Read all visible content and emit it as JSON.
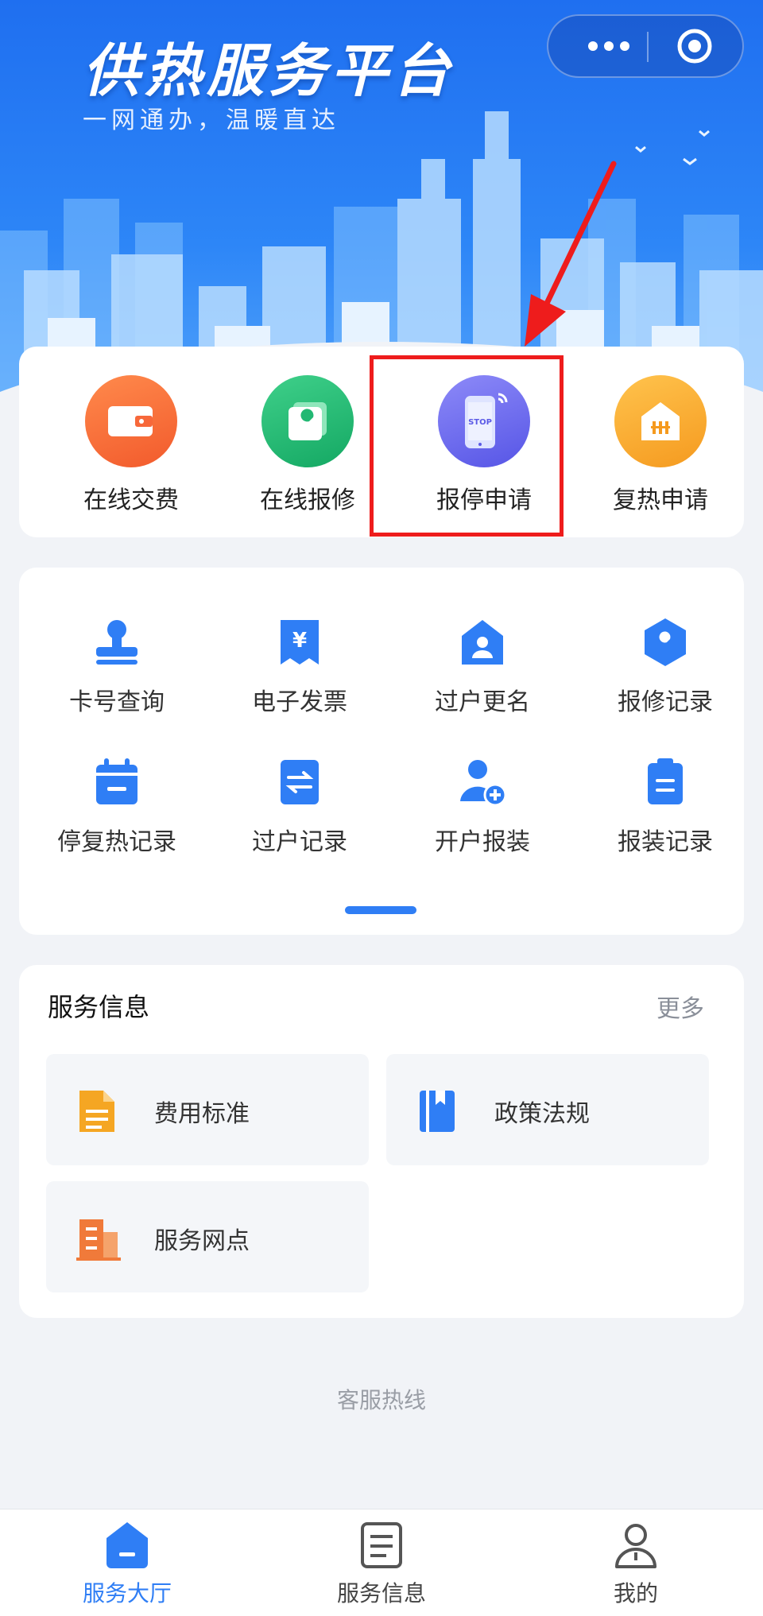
{
  "header": {
    "title": "供热服务平台",
    "subtitle": "一网通办，温暖直达",
    "more_icon": "more-dots-icon",
    "close_icon": "target-icon"
  },
  "quick_actions": [
    {
      "label": "在线交费",
      "icon": "wallet-icon",
      "color": "#f7683a"
    },
    {
      "label": "在线报修",
      "icon": "wrench-icon",
      "color": "#22b873"
    },
    {
      "label": "报停申请",
      "icon": "stop-phone-icon",
      "color": "#6d6cf0",
      "highlighted": true
    },
    {
      "label": "复热申请",
      "icon": "heater-house-icon",
      "color": "#f7a52b"
    }
  ],
  "services": [
    {
      "label": "卡号查询",
      "icon": "stamp-icon"
    },
    {
      "label": "电子发票",
      "icon": "yuan-receipt-icon"
    },
    {
      "label": "过户更名",
      "icon": "house-user-icon"
    },
    {
      "label": "报修记录",
      "icon": "wrench-hex-icon"
    },
    {
      "label": "停复热记录",
      "icon": "calendar-icon"
    },
    {
      "label": "过户记录",
      "icon": "transfer-doc-icon"
    },
    {
      "label": "开户报装",
      "icon": "add-user-icon"
    },
    {
      "label": "报装记录",
      "icon": "clipboard-icon"
    }
  ],
  "info": {
    "title": "服务信息",
    "more": "更多",
    "tiles": [
      {
        "label": "费用标准",
        "icon": "document-icon",
        "color": "#f5a623"
      },
      {
        "label": "政策法规",
        "icon": "book-icon",
        "color": "#2f7ef5"
      },
      {
        "label": "服务网点",
        "icon": "building-icon",
        "color": "#f07a3a"
      }
    ]
  },
  "hotline": "客服热线",
  "tabbar": [
    {
      "label": "服务大厅",
      "icon": "hall-icon",
      "active": true
    },
    {
      "label": "服务信息",
      "icon": "list-doc-icon",
      "active": false
    },
    {
      "label": "我的",
      "icon": "person-icon",
      "active": false
    }
  ],
  "colors": {
    "primary": "#2f7ef5",
    "highlight_box": "#ee1c1c"
  }
}
